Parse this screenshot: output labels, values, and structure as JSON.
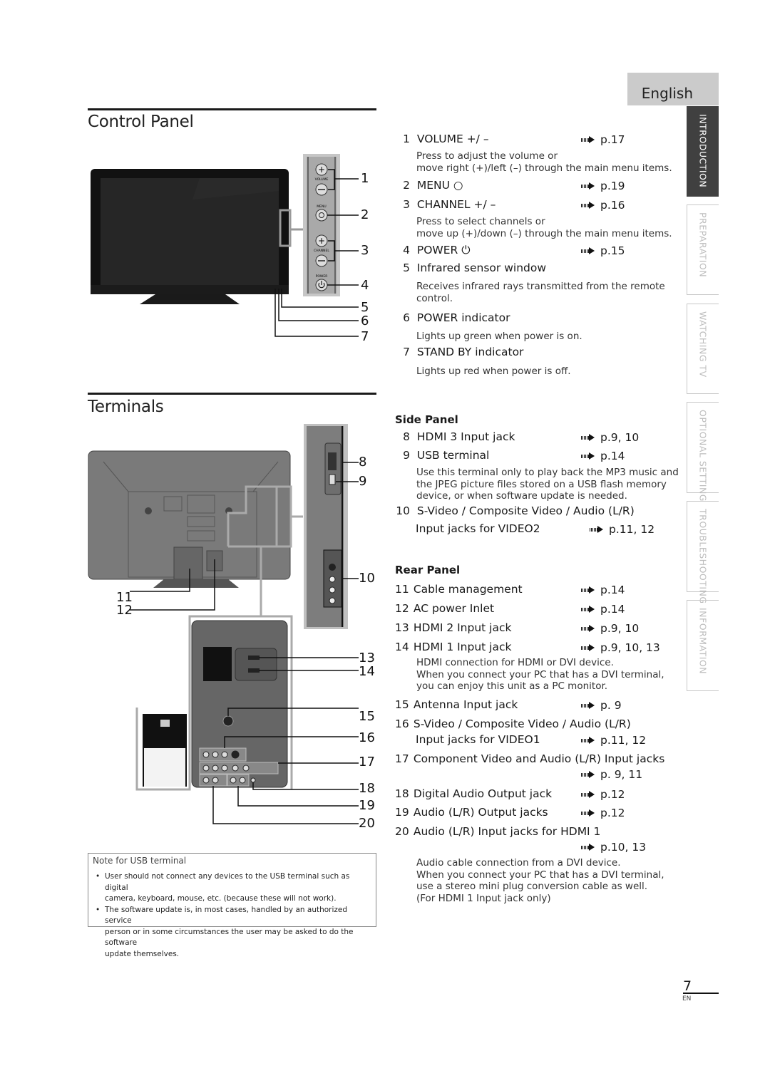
{
  "language_tab": "English",
  "side_tabs": [
    {
      "label": "INTRODUCTION",
      "active": true
    },
    {
      "label": "PREPARATION",
      "active": false
    },
    {
      "label": "WATCHING TV",
      "active": false
    },
    {
      "label": "OPTIONAL SETTING",
      "active": false
    },
    {
      "label": "TROUBLESHOOTING",
      "active": false
    },
    {
      "label": "INFORMATION",
      "active": false
    }
  ],
  "control_panel": {
    "title": "Control Panel",
    "figure_labels": {
      "volume": "VOLUME",
      "menu": "MENU",
      "channel": "CHANNEL",
      "power": "POWER"
    },
    "callouts": [
      "1",
      "2",
      "3",
      "4",
      "5",
      "6",
      "7"
    ],
    "items": [
      {
        "num": "1",
        "label": "VOLUME +/ –",
        "ref": "p.17",
        "desc": [
          "Press to adjust the volume or",
          "move right (+)/left (–) through the main menu items."
        ]
      },
      {
        "num": "2",
        "label": "MENU ○",
        "ref": "p.19"
      },
      {
        "num": "3",
        "label": "CHANNEL +/ –",
        "ref": "p.16",
        "desc": [
          "Press to select channels or",
          "move up (+)/down (–) through the main menu items."
        ]
      },
      {
        "num": "4",
        "label": "POWER ⏻",
        "ref": "p.15"
      },
      {
        "num": "5",
        "label": "Infrared sensor window",
        "desc": [
          "Receives infrared rays transmitted from the remote",
          "control."
        ]
      },
      {
        "num": "6",
        "label": "POWER indicator",
        "desc": [
          "Lights up green when power is on."
        ]
      },
      {
        "num": "7",
        "label": "STAND BY indicator",
        "desc": [
          "Lights up red when power is off."
        ]
      }
    ]
  },
  "terminals": {
    "title": "Terminals",
    "callouts": [
      "8",
      "9",
      "10",
      "11",
      "12",
      "13",
      "14",
      "15",
      "16",
      "17",
      "18",
      "19",
      "20"
    ],
    "side_panel": {
      "heading": "Side Panel",
      "items": [
        {
          "num": "8",
          "label": "HDMI 3 Input jack",
          "ref": "p.9, 10"
        },
        {
          "num": "9",
          "label": "USB terminal",
          "ref": "p.14",
          "desc": [
            "Use this terminal only to play back the MP3 music and",
            "the JPEG picture files stored on a USB flash memory",
            "device, or when software update is needed."
          ]
        },
        {
          "num": "10",
          "label": "S-Video / Composite Video / Audio (L/R)",
          "label2": "Input jacks for VIDEO2",
          "ref": "p.11, 12"
        }
      ]
    },
    "rear_panel": {
      "heading": "Rear Panel",
      "items": [
        {
          "num": "11",
          "label": "Cable management",
          "ref": "p.14"
        },
        {
          "num": "12",
          "label": "AC power Inlet",
          "ref": "p.14"
        },
        {
          "num": "13",
          "label": "HDMI 2 Input jack",
          "ref": "p.9, 10"
        },
        {
          "num": "14",
          "label": "HDMI 1 Input jack",
          "ref": "p.9, 10, 13",
          "desc": [
            "HDMI connection for HDMI or DVI device.",
            "When you connect your PC that has a DVI terminal,",
            "you can enjoy this unit as a PC monitor."
          ]
        },
        {
          "num": "15",
          "label": "Antenna Input jack",
          "ref": "p. 9"
        },
        {
          "num": "16",
          "label": "S-Video / Composite Video / Audio (L/R)",
          "label2": "Input jacks for VIDEO1",
          "ref": "p.11, 12"
        },
        {
          "num": "17",
          "label": "Component Video and Audio (L/R) Input jacks",
          "ref": "p. 9, 11"
        },
        {
          "num": "18",
          "label": "Digital Audio Output jack",
          "ref": "p.12"
        },
        {
          "num": "19",
          "label": "Audio (L/R) Output jacks",
          "ref": "p.12"
        },
        {
          "num": "20",
          "label": "Audio (L/R) Input jacks for HDMI 1",
          "ref": "p.10, 13",
          "desc": [
            "Audio cable connection from a DVI device.",
            "When you connect your PC that has a DVI terminal,",
            "use a stereo mini plug conversion cable as well.",
            "(For HDMI 1 Input jack only)"
          ]
        }
      ]
    }
  },
  "usb_note": {
    "title": "Note for USB terminal",
    "bullets": [
      [
        "User should not connect any devices to the USB terminal such as digital",
        "camera, keyboard, mouse, etc. (because these will not work)."
      ],
      [
        "The software update is, in most cases, handled by an authorized service",
        "person or in some circumstances the user may be asked to do the software",
        "update themselves."
      ]
    ]
  },
  "footer": {
    "page_number": "7",
    "lang_code": "EN"
  }
}
